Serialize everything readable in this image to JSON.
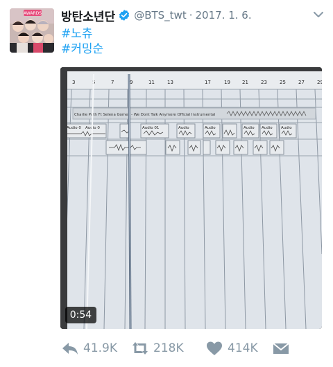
{
  "tweet": {
    "name": "방탄소년단",
    "handle": "@BTS_twt",
    "separator": "·",
    "date": "2017. 1. 6.",
    "hashtags": [
      "#노츄",
      "#커밍순"
    ],
    "avatar_text": "AWARDS"
  },
  "video": {
    "duration": "0:54",
    "ruler_numbers": [
      "3",
      "5",
      "7",
      "9",
      "11",
      "13",
      "17",
      "19",
      "21",
      "23",
      "25",
      "27",
      "29"
    ],
    "track_title": "Charlie Puth Ft Selena Gomez - We Dont Talk Anymore Official Instrumental",
    "clip_labels": [
      "Audio 0",
      "Audio 0",
      "Audio 01",
      "Audio",
      "Audio",
      "Audio",
      "Audio",
      "Audio"
    ]
  },
  "actions": {
    "replies": "41.9K",
    "retweets": "218K",
    "likes": "414K"
  },
  "colors": {
    "link": "#1da1f2",
    "muted": "#657786",
    "icon": "#8899a6",
    "verified": "#1da1f2"
  }
}
